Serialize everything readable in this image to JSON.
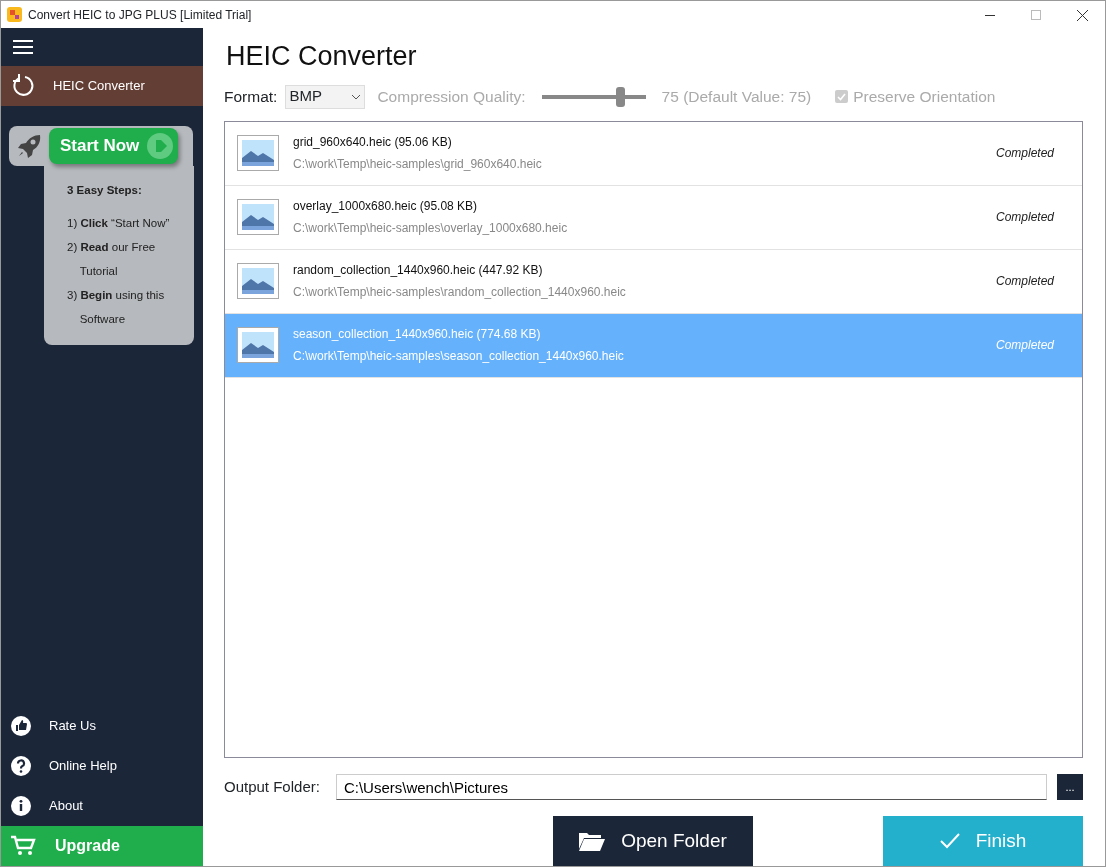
{
  "window": {
    "title": "Convert HEIC to JPG PLUS [Limited Trial]"
  },
  "sidebar": {
    "items": [
      {
        "label": "HEIC Converter",
        "selected": true
      }
    ],
    "promo": {
      "button": "Start Now",
      "heading": "3 Easy Steps:",
      "steps": [
        "1) **Click** “Start Now”",
        "2) **Read** our Free Tutorial",
        "3) **Begin** using this Software"
      ]
    },
    "bottom_items": [
      {
        "kind": "rate",
        "label": "Rate Us"
      },
      {
        "kind": "help",
        "label": "Online Help"
      },
      {
        "kind": "about",
        "label": "About"
      }
    ],
    "upgrade": "Upgrade"
  },
  "heading": "HEIC Converter",
  "options": {
    "format_label": "Format:",
    "format": "BMP",
    "quality_label": "Compression Quality:",
    "quality": {
      "level": 0.75,
      "disabled": true
    },
    "quality_reading": "75 (Default Value: 75)",
    "preserve_orientation": {
      "label": "Preserve Orientation",
      "checked": true,
      "disabled": true
    }
  },
  "files": [
    {
      "name": "grid_960x640.heic (95.06 KB)",
      "path": "C:\\work\\Temp\\heic-samples\\grid_960x640.heic",
      "status": "Completed",
      "selected": false
    },
    {
      "name": "overlay_1000x680.heic (95.08 KB)",
      "path": "C:\\work\\Temp\\heic-samples\\overlay_1000x680.heic",
      "status": "Completed",
      "selected": false
    },
    {
      "name": "random_collection_1440x960.heic (447.92 KB)",
      "path": "C:\\work\\Temp\\heic-samples\\random_collection_1440x960.heic",
      "status": "Completed",
      "selected": false
    },
    {
      "name": "season_collection_1440x960.heic (774.68 KB)",
      "path": "C:\\work\\Temp\\heic-samples\\season_collection_1440x960.heic",
      "status": "Completed",
      "selected": true
    }
  ],
  "output": {
    "label": "Output Folder:",
    "value": "C:\\Users\\wench\\Pictures",
    "browse": "..."
  },
  "buttons": [
    {
      "kind": "open",
      "label": "Open Folder"
    },
    {
      "kind": "finish",
      "label": "Finish"
    }
  ]
}
